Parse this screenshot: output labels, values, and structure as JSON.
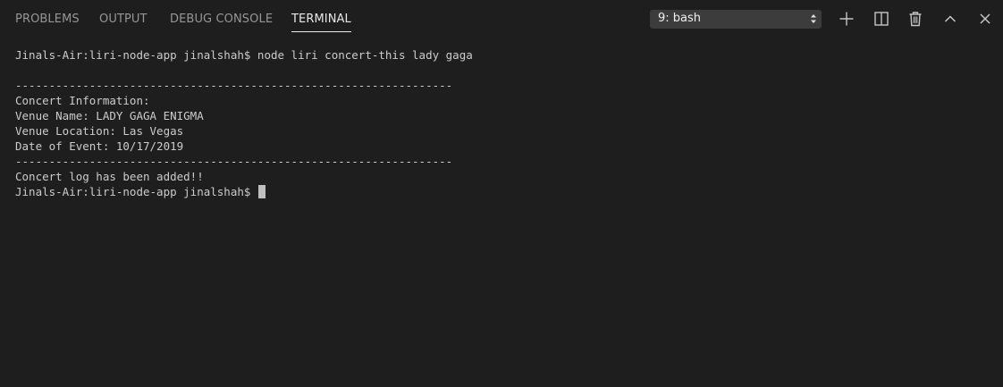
{
  "tabs": [
    {
      "label": "PROBLEMS"
    },
    {
      "label": "OUTPUT"
    },
    {
      "label": "DEBUG CONSOLE"
    },
    {
      "label": "TERMINAL",
      "active": true
    }
  ],
  "terminal_select": {
    "value": "9: bash"
  },
  "toolbar": {
    "icons": [
      "plus-icon",
      "split-terminal-icon",
      "trash-icon",
      "chevron-up-icon",
      "close-icon"
    ]
  },
  "terminal": {
    "lines": [
      "Jinals-Air:liri-node-app jinalshah$ node liri concert-this lady gaga",
      "",
      "-----------------------------------------------------------------",
      "Concert Information:",
      "Venue Name: LADY GAGA ENIGMA",
      "Venue Location: Las Vegas",
      "Date of Event: 10/17/2019",
      "-----------------------------------------------------------------",
      "Concert log has been added!!",
      "Jinals-Air:liri-node-app jinalshah$ "
    ]
  },
  "colors": {
    "background": "#1e1e1e",
    "text": "#cccccc",
    "inactive_tab": "#969696",
    "active_tab": "#e7e7e7",
    "select_bg": "#3c3c3c"
  }
}
